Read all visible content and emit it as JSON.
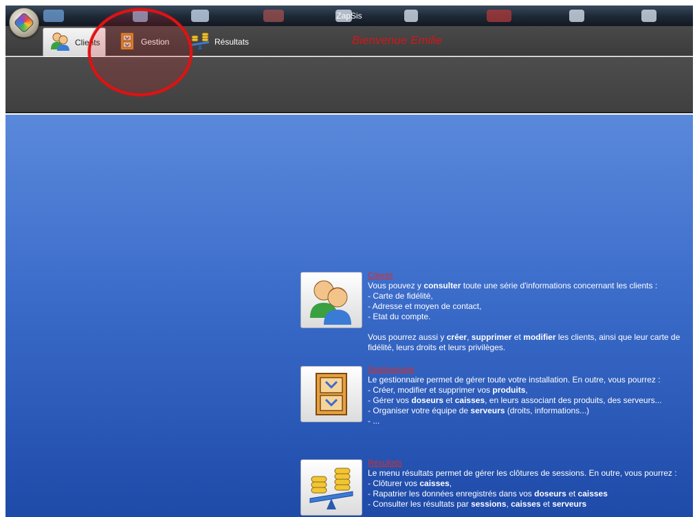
{
  "window": {
    "title": "ZapSis"
  },
  "colors": {
    "accent_red": "#d11818",
    "main_blue": "#3b6cca"
  },
  "ribbon": {
    "tabs": [
      {
        "label": "Clients",
        "icon": "users-icon"
      },
      {
        "label": "Gestion",
        "icon": "cabinet-icon"
      },
      {
        "label": "Résultats",
        "icon": "balance-icon"
      }
    ],
    "welcome": "Bienvenue Emilie"
  },
  "sections": {
    "clients": {
      "title": "Clients",
      "intro_a": "Vous pouvez y ",
      "intro_b": "consulter",
      "intro_c": " toute une série d'informations concernant les clients :",
      "items": [
        "- Carte de fidélité,",
        "- Adresse et moyen de contact,",
        "- Etat du compte."
      ],
      "more_a": "Vous pourrez aussi y ",
      "more_b": "créer",
      "more_c": ", ",
      "more_d": "supprimer",
      "more_e": " et ",
      "more_f": "modifier",
      "more_g": " les clients, ainsi que leur carte de fidélité, leurs droits et leurs privilèges."
    },
    "gestion": {
      "title": "Gestionnaire",
      "intro": "Le gestionnaire permet de gérer toute votre installation. En outre, vous pourrez :",
      "l1_a": "- Créer, modifier et supprimer vos ",
      "l1_b": "produits",
      "l1_c": ",",
      "l2_a": "- Gérer vos ",
      "l2_b": "doseurs",
      "l2_c": " et ",
      "l2_d": "caisses",
      "l2_e": ", en leurs associant des produits, des serveurs...",
      "l3_a": "- Organiser votre équipe de ",
      "l3_b": "serveurs",
      "l3_c": " (droits, informations...)",
      "l4": "- ..."
    },
    "resultats": {
      "title": "Résultats",
      "intro": "Le menu résultats permet de gérer les clôtures de sessions. En outre, vous pourrez :",
      "l1_a": "- Clôturer vos ",
      "l1_b": "caisses",
      "l1_c": ",",
      "l2_a": "- Rapatrier les données enregistrés dans vos ",
      "l2_b": "doseurs",
      "l2_c": " et ",
      "l2_d": "caisses",
      "l3_a": "- Consulter les résultats par ",
      "l3_b": "sessions",
      "l3_c": ", ",
      "l3_d": "caisses",
      "l3_e": " et ",
      "l3_f": "serveurs"
    }
  }
}
